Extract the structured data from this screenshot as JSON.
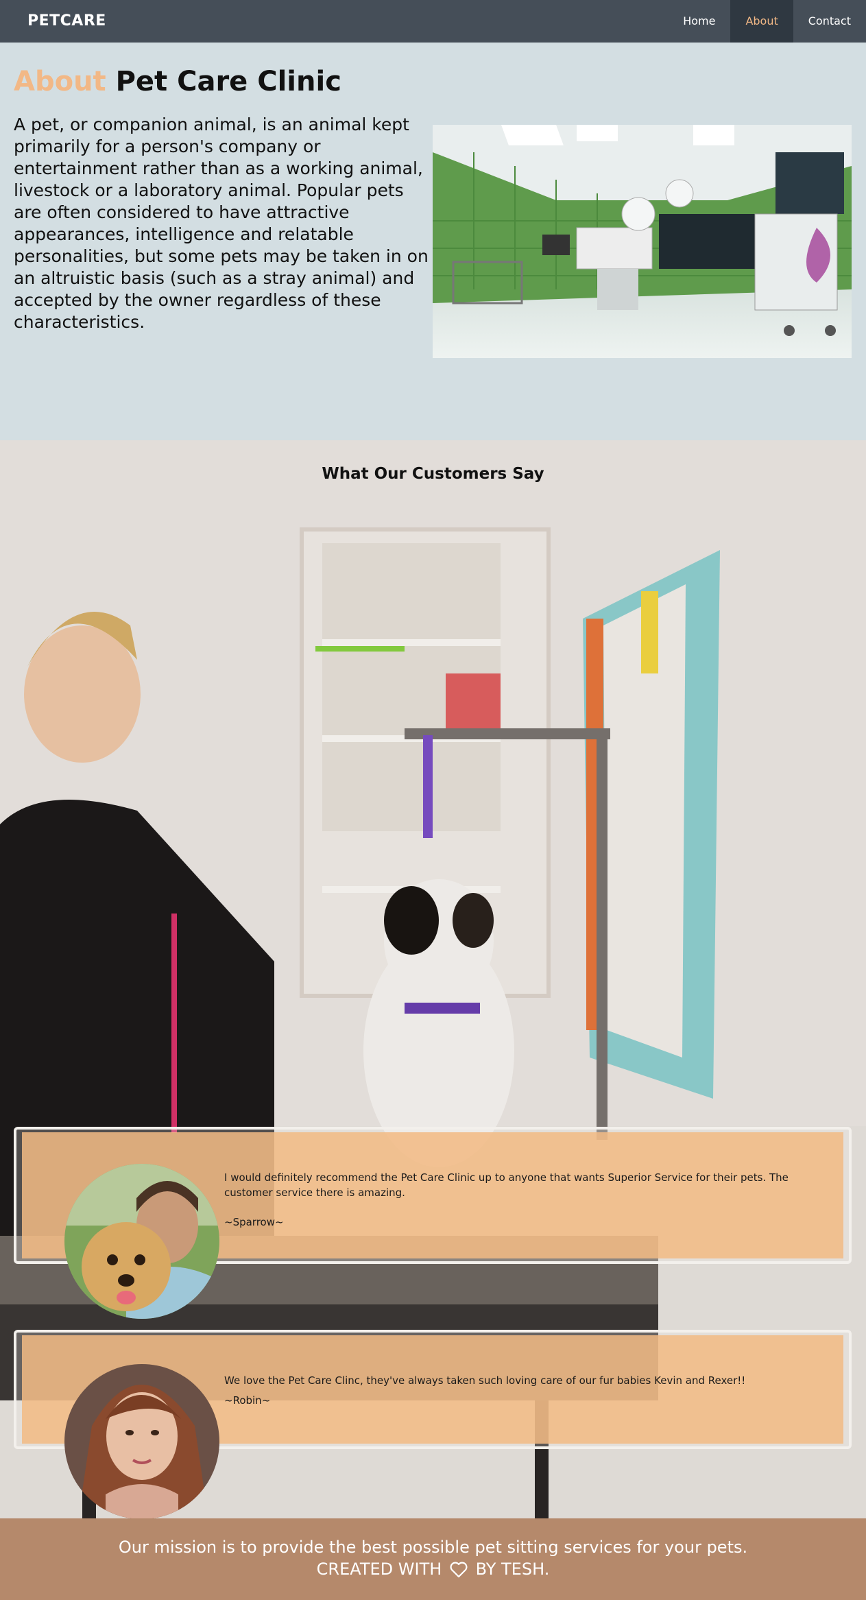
{
  "nav": {
    "brand": "PETCARE",
    "links": [
      {
        "label": "Home"
      },
      {
        "label": "About"
      },
      {
        "label": "Contact"
      }
    ]
  },
  "about": {
    "title_accent": "About",
    "title_rest": "Pet Care Clinic",
    "body": "A pet, or companion animal, is an animal kept primarily for a person's company or entertainment rather than as a working animal, livestock or a laboratory animal. Popular pets are often considered to have attractive appearances, intelligence and relatable personalities, but some pets may be taken in on an altruistic basis (such as a stray animal) and accepted by the owner regardless of these characteristics."
  },
  "testimonials": {
    "heading": "What Our Customers Say",
    "items": [
      {
        "text": "I would definitely recommend the Pet Care Clinic up to anyone that wants Superior Service for their pets. The customer service there is amazing.",
        "author": "~Sparrow~"
      },
      {
        "text": "We love the Pet Care Clinc, they've always taken such loving care of our fur babies Kevin and Rexer!!",
        "author": "~Robin~"
      }
    ]
  },
  "footer": {
    "mission": "Our mission is to provide the best possible pet sitting services for your pets.",
    "created_prefix": "CREATED WITH",
    "created_suffix": "BY TESH."
  },
  "colors": {
    "nav_bg": "#454e58",
    "accent": "#f2b886",
    "about_bg": "#d3dee2",
    "card_bg": "#f2ba84",
    "footer_bg": "#b5896b"
  }
}
